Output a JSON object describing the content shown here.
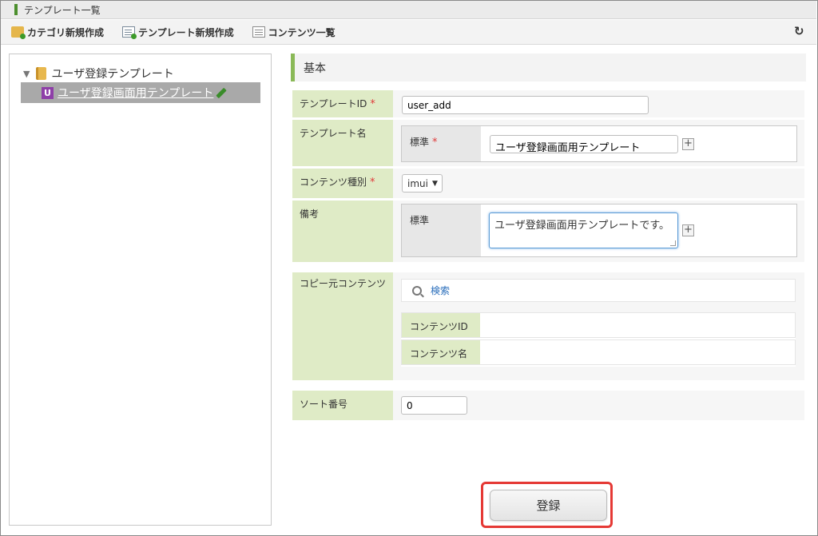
{
  "window": {
    "title": "テンプレート一覧"
  },
  "toolbar": {
    "category_new": "カテゴリ新規作成",
    "template_new": "テンプレート新規作成",
    "content_list": "コンテンツ一覧"
  },
  "tree": {
    "root_label": "ユーザ登録テンプレート",
    "child_badge": "U",
    "child_label": "ユーザ登録画面用テンプレート"
  },
  "form": {
    "section_title": "基本",
    "required_mark": "*",
    "template_id": {
      "label": "テンプレートID",
      "value": "user_add"
    },
    "template_name": {
      "label": "テンプレート名",
      "sub_label": "標準",
      "value": "ユーザ登録画面用テンプレート",
      "plus": "+"
    },
    "content_type": {
      "label": "コンテンツ種別",
      "value": "imui",
      "caret": "▼"
    },
    "remarks": {
      "label": "備考",
      "sub_label": "標準",
      "value": "ユーザ登録画面用テンプレートです。",
      "plus": "+"
    },
    "copy_source": {
      "label": "コピー元コンテンツ",
      "search_label": "検索",
      "content_id_label": "コンテンツID",
      "content_name_label": "コンテンツ名"
    },
    "sort_order": {
      "label": "ソート番号",
      "value": "0"
    }
  },
  "submit": {
    "label": "登録"
  },
  "icons": {
    "refresh": "↻"
  }
}
